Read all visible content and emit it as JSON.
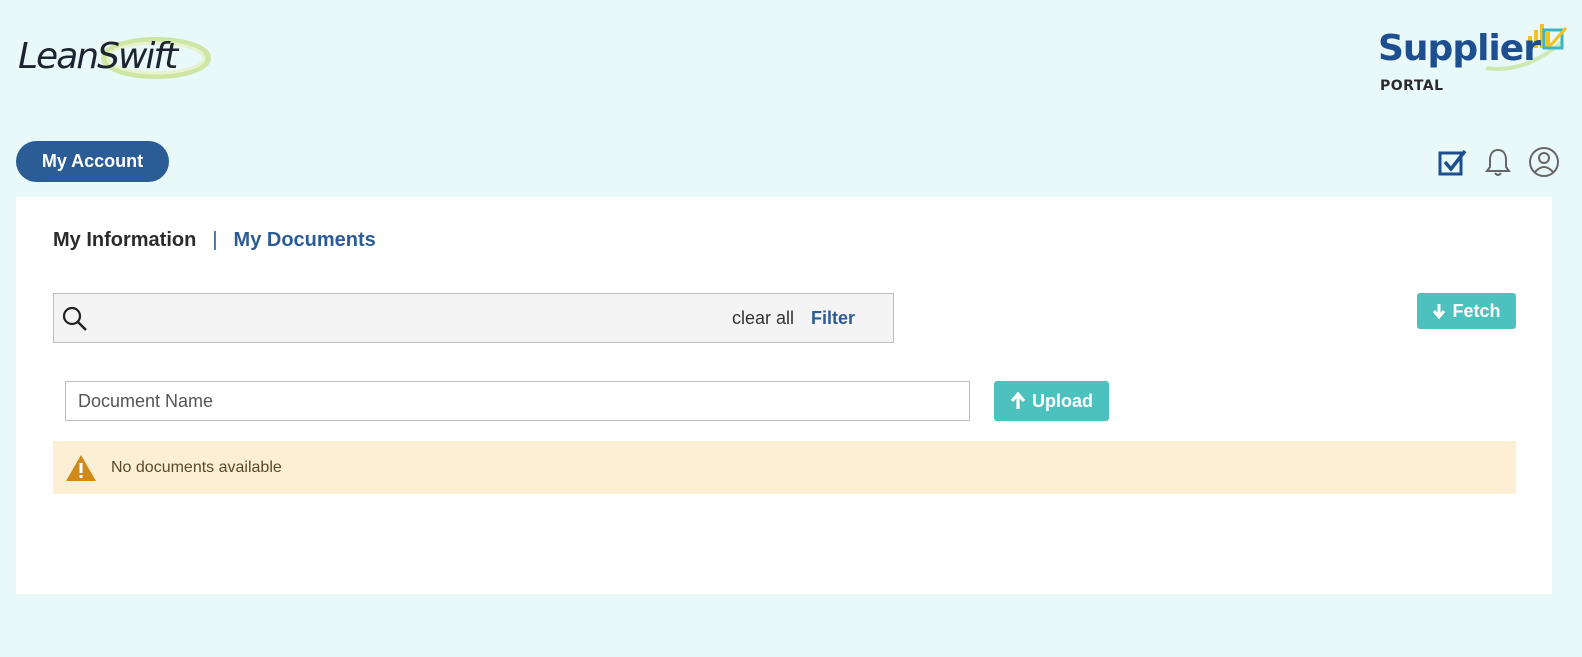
{
  "header": {
    "left_logo": {
      "part1": "Lean",
      "part2": "Swift"
    },
    "right_logo": {
      "title": "Supplier",
      "subtitle": "PORTAL"
    }
  },
  "nav": {
    "account_button": "My Account",
    "icons": [
      "checkbox-icon",
      "bell-icon",
      "user-icon"
    ]
  },
  "tabs": {
    "info": "My Information",
    "separator": "|",
    "documents": "My Documents"
  },
  "search": {
    "value": "",
    "placeholder": "",
    "clear_label": "clear all",
    "filter_label": "Filter"
  },
  "fetch_label": "Fetch",
  "document_form": {
    "name_placeholder": "Document Name",
    "upload_label": "Upload"
  },
  "alert": {
    "message": "No documents available"
  },
  "colors": {
    "background": "#e9f8f8",
    "primary": "#2c5c96",
    "accent": "#4cc1be",
    "warning_bg": "#fdefd4",
    "warning_icon": "#d08a1a"
  }
}
